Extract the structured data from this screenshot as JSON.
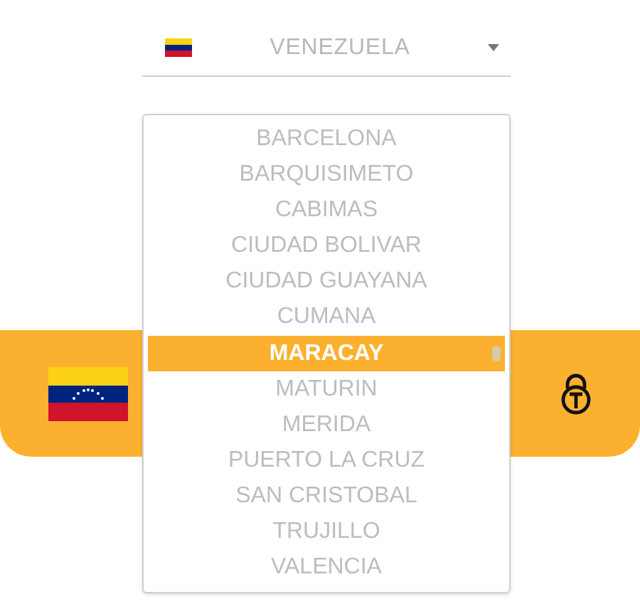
{
  "country_select": {
    "value": "VENEZUELA"
  },
  "city_list": [
    {
      "label": "BARCELONA",
      "selected": false
    },
    {
      "label": "BARQUISIMETO",
      "selected": false
    },
    {
      "label": "CABIMAS",
      "selected": false
    },
    {
      "label": "CIUDAD BOLIVAR",
      "selected": false
    },
    {
      "label": "CIUDAD GUAYANA",
      "selected": false
    },
    {
      "label": "CUMANA",
      "selected": false
    },
    {
      "label": "MARACAY",
      "selected": true
    },
    {
      "label": "MATURIN",
      "selected": false
    },
    {
      "label": "MERIDA",
      "selected": false
    },
    {
      "label": "PUERTO LA CRUZ",
      "selected": false
    },
    {
      "label": "SAN CRISTOBAL",
      "selected": false
    },
    {
      "label": "TRUJILLO",
      "selected": false
    },
    {
      "label": "VALENCIA",
      "selected": false
    }
  ]
}
